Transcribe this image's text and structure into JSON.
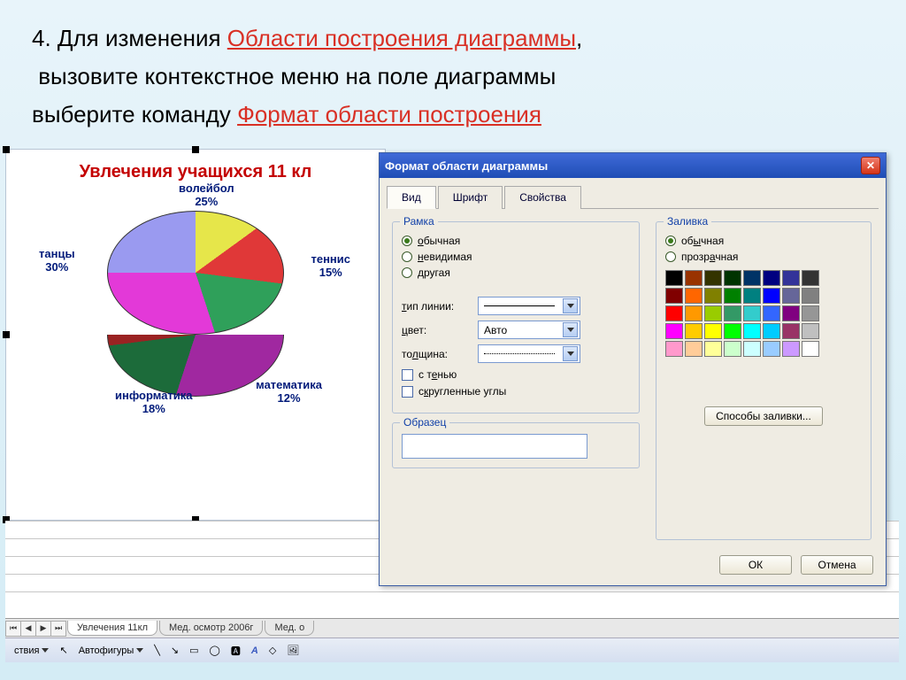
{
  "instruction": {
    "prefix": "4. Для изменения ",
    "highlight1": "Области построения диаграммы",
    "line2": "вызовите контекстное меню на поле диаграммы",
    "line3_prefix": "выберите команду ",
    "highlight2": "Формат области построения"
  },
  "chart_data": {
    "type": "pie",
    "title": "Увлечения учащихся 11 кл",
    "series": [
      {
        "name": "волейбол",
        "value": 25,
        "label": "волейбол\n25%",
        "color": "#9a9af0"
      },
      {
        "name": "теннис",
        "value": 15,
        "label": "теннис\n15%",
        "color": "#e6e64a"
      },
      {
        "name": "математика",
        "value": 12,
        "label": "математика\n12%",
        "color": "#e03838"
      },
      {
        "name": "информатика",
        "value": 18,
        "label": "информатика\n18%",
        "color": "#2fa05a"
      },
      {
        "name": "танцы",
        "value": 30,
        "label": "танцы\n30%",
        "color": "#e339d8"
      }
    ]
  },
  "pie_labels": {
    "l0": "волейбол",
    "p0": "25%",
    "l1": "теннис",
    "p1": "15%",
    "l2": "математика",
    "p2": "12%",
    "l3": "информатика",
    "p3": "18%",
    "l4": "танцы",
    "p4": "30%"
  },
  "sheets": {
    "tab1": "Увлечения 11кл",
    "tab2": "Мед. осмотр 2006г",
    "tab3": "Мед. о"
  },
  "toolbar": {
    "actions": "ствия",
    "autoshapes": "Автофигуры"
  },
  "dialog": {
    "title": "Формат области диаграммы",
    "tabs": {
      "view": "Вид",
      "font": "Шрифт",
      "props": "Свойства"
    },
    "frame": {
      "legend": "Рамка",
      "normal": "обычная",
      "invisible": "невидимая",
      "other": "другая",
      "linetype": "тип линии:",
      "color": "цвет:",
      "color_value": "Авто",
      "thickness": "толщина:",
      "shadow": "с тенью",
      "rounded": "скругленные углы"
    },
    "fill": {
      "legend": "Заливка",
      "normal": "обычная",
      "transparent": "прозрачная",
      "methods": "Способы заливки...",
      "palette": [
        "#000000",
        "#993300",
        "#333300",
        "#003300",
        "#003366",
        "#000080",
        "#333399",
        "#333333",
        "#800000",
        "#ff6600",
        "#808000",
        "#008000",
        "#008080",
        "#0000ff",
        "#666699",
        "#808080",
        "#ff0000",
        "#ff9900",
        "#99cc00",
        "#339966",
        "#33cccc",
        "#3366ff",
        "#800080",
        "#969696",
        "#ff00ff",
        "#ffcc00",
        "#ffff00",
        "#00ff00",
        "#00ffff",
        "#00ccff",
        "#993366",
        "#c0c0c0",
        "#ff99cc",
        "#ffcc99",
        "#ffff99",
        "#ccffcc",
        "#ccffff",
        "#99ccff",
        "#cc99ff",
        "#ffffff"
      ]
    },
    "sample": "Образец",
    "ok": "ОК",
    "cancel": "Отмена"
  }
}
